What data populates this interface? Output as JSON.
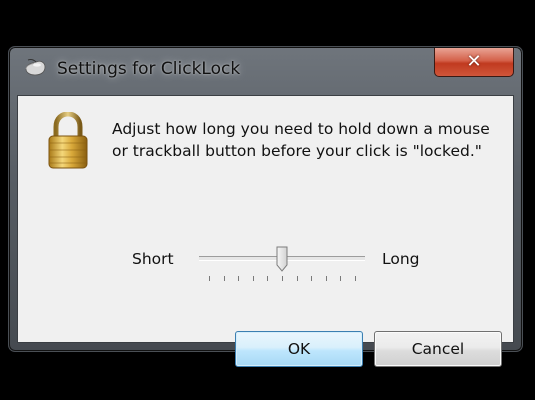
{
  "window": {
    "title": "Settings for ClickLock",
    "close_label": "✕",
    "title_icon": "mouse-icon"
  },
  "dialog": {
    "icon": "padlock-icon",
    "message": "Adjust how long you need to hold down a mouse or trackball button before your click is \"locked.\"",
    "slider": {
      "min_label": "Short",
      "max_label": "Long",
      "value_fraction": 0.5,
      "tick_count": 11
    },
    "buttons": {
      "ok": "OK",
      "cancel": "Cancel"
    }
  },
  "colors": {
    "ok_border": "#3c7fb1",
    "close_red": "#c03a1f"
  }
}
